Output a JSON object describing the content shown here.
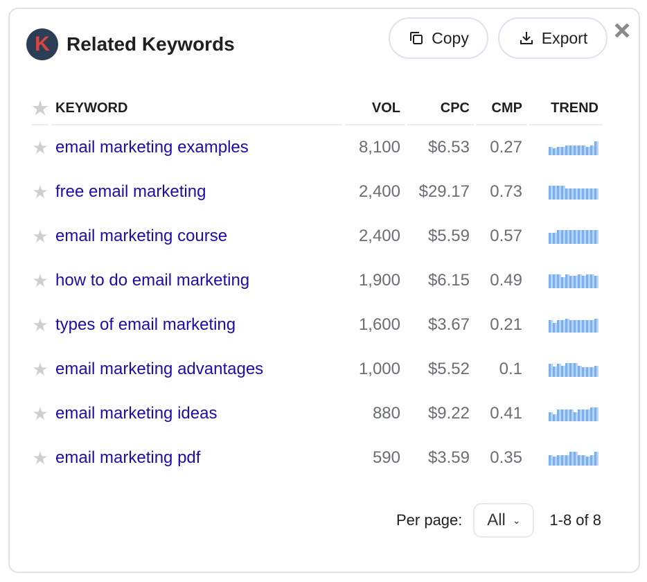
{
  "header": {
    "logo_letter": "K",
    "title": "Related Keywords",
    "copy_label": "Copy",
    "export_label": "Export"
  },
  "table": {
    "columns": [
      "KEYWORD",
      "VOL",
      "CPC",
      "CMP",
      "TREND"
    ],
    "rows": [
      {
        "keyword": "email marketing examples",
        "vol": "8,100",
        "cpc": "$6.53",
        "cmp": "0.27",
        "trend": [
          0.6,
          0.5,
          0.6,
          0.6,
          0.7,
          0.7,
          0.7,
          0.7,
          0.7,
          0.6,
          0.7,
          1.0
        ]
      },
      {
        "keyword": "free email marketing",
        "vol": "2,400",
        "cpc": "$29.17",
        "cmp": "0.73",
        "trend": [
          1.0,
          1.0,
          1.0,
          1.0,
          0.8,
          0.8,
          0.8,
          0.8,
          0.8,
          0.8,
          0.8,
          0.8
        ]
      },
      {
        "keyword": "email marketing course",
        "vol": "2,400",
        "cpc": "$5.59",
        "cmp": "0.57",
        "trend": [
          0.8,
          0.8,
          1.0,
          1.0,
          1.0,
          1.0,
          1.0,
          1.0,
          1.0,
          1.0,
          1.0,
          1.0
        ]
      },
      {
        "keyword": "how to do email marketing",
        "vol": "1,900",
        "cpc": "$6.15",
        "cmp": "0.49",
        "trend": [
          1.0,
          1.0,
          1.0,
          0.8,
          1.0,
          0.9,
          0.9,
          1.0,
          0.9,
          1.0,
          1.0,
          0.9
        ]
      },
      {
        "keyword": "types of email marketing",
        "vol": "1,600",
        "cpc": "$3.67",
        "cmp": "0.21",
        "trend": [
          0.9,
          0.7,
          0.9,
          0.9,
          1.0,
          0.9,
          0.9,
          0.9,
          0.9,
          0.9,
          0.9,
          1.0
        ]
      },
      {
        "keyword": "email marketing advantages",
        "vol": "1,000",
        "cpc": "$5.52",
        "cmp": "0.1",
        "trend": [
          0.95,
          0.75,
          0.95,
          0.8,
          1.0,
          1.0,
          1.0,
          0.8,
          0.7,
          0.7,
          0.7,
          0.8
        ]
      },
      {
        "keyword": "email marketing ideas",
        "vol": "880",
        "cpc": "$9.22",
        "cmp": "0.41",
        "trend": [
          0.65,
          0.5,
          0.85,
          0.85,
          0.85,
          0.85,
          0.65,
          0.85,
          0.85,
          0.85,
          1.0,
          1.0
        ]
      },
      {
        "keyword": "email marketing pdf",
        "vol": "590",
        "cpc": "$3.59",
        "cmp": "0.35",
        "trend": [
          0.75,
          0.65,
          0.75,
          0.75,
          0.75,
          1.0,
          1.0,
          0.75,
          0.75,
          0.65,
          0.75,
          1.0
        ]
      }
    ]
  },
  "footer": {
    "per_page_label": "Per page:",
    "per_page_value": "All",
    "range_text": "1-8 of 8"
  },
  "colors": {
    "link": "#1a0dab",
    "spark_dark": "#7eaeea",
    "spark_light": "#b8d3f4",
    "logo_bg": "#2c3e55",
    "logo_letter": "#d9473f"
  }
}
